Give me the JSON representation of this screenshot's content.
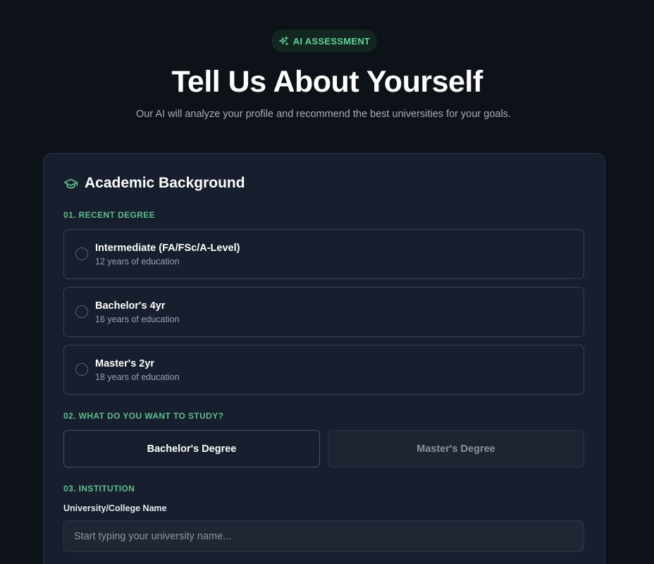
{
  "header": {
    "badge_label": "AI ASSESSMENT",
    "title": "Tell Us About Yourself",
    "subtitle": "Our AI will analyze your profile and recommend the best universities for your goals."
  },
  "section": {
    "title": "Academic Background"
  },
  "degree": {
    "label": "01. RECENT DEGREE",
    "options": [
      {
        "title": "Intermediate (FA/FSc/A-Level)",
        "subtitle": "12 years of education"
      },
      {
        "title": "Bachelor's 4yr",
        "subtitle": "16 years of education"
      },
      {
        "title": "Master's 2yr",
        "subtitle": "18 years of education"
      }
    ]
  },
  "study": {
    "label": "02. WHAT DO YOU WANT TO STUDY?",
    "options": [
      "Bachelor's Degree",
      "Master's Degree"
    ],
    "selected": "Bachelor's Degree"
  },
  "institution": {
    "label": "03. INSTITUTION",
    "field_label": "University/College Name",
    "placeholder": "Start typing your university name...",
    "value": ""
  },
  "colors": {
    "accent": "#5fbf8a",
    "background": "#0d1118",
    "card": "#171e2d"
  },
  "icons": {
    "badge": "sparkles-icon",
    "section": "graduation-cap-icon"
  }
}
